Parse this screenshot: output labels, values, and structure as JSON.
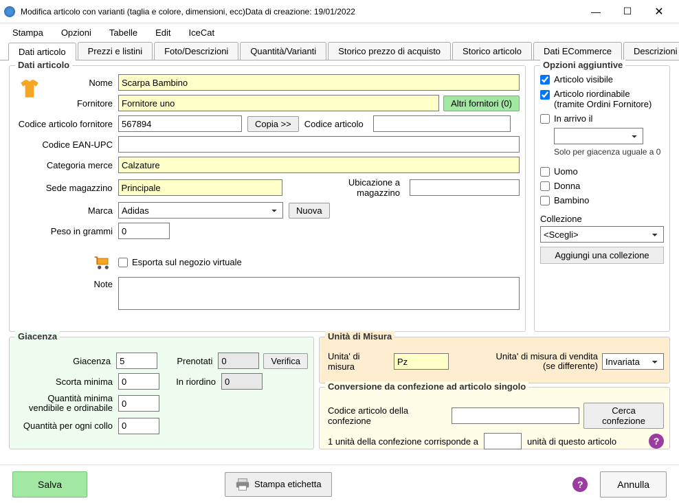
{
  "window": {
    "title": "Modifica articolo con varianti (taglia e colore, dimensioni, ecc)Data di creazione: 19/01/2022"
  },
  "menu": {
    "stampa": "Stampa",
    "opzioni": "Opzioni",
    "tabelle": "Tabelle",
    "edit": "Edit",
    "icecat": "IceCat"
  },
  "tabs": [
    "Dati articolo",
    "Prezzi e listini",
    "Foto/Descrizioni",
    "Quantità/Varianti",
    "Storico prezzo di acquisto",
    "Storico articolo",
    "Dati ECommerce",
    "Descrizioni  E..."
  ],
  "article": {
    "group_title": "Dati articolo",
    "nome_lbl": "Nome",
    "nome_val": "Scarpa Bambino",
    "fornitore_lbl": "Fornitore",
    "fornitore_val": "Fornitore uno",
    "altri_fornitori": "Altri fornitori (0)",
    "codice_fornitore_lbl": "Codice articolo fornitore",
    "codice_fornitore_val": "567894",
    "copia": "Copia >>",
    "codice_articolo_lbl": "Codice articolo",
    "codice_articolo_val": "",
    "ean_lbl": "Codice EAN-UPC",
    "ean_val": "",
    "categoria_lbl": "Categoria merce",
    "categoria_val": "Calzature",
    "sede_lbl": "Sede magazzino",
    "sede_val": "Principale",
    "ubicazione_lbl": "Ubicazione a magazzino",
    "ubicazione_val": "",
    "marca_lbl": "Marca",
    "marca_val": "Adidas",
    "nuova": "Nuova",
    "peso_lbl": "Peso in grammi",
    "peso_val": "0",
    "esporta_lbl": "Esporta sul negozio virtuale",
    "note_lbl": "Note",
    "note_val": ""
  },
  "options": {
    "group_title": "Opzioni aggiuntive",
    "visibile": "Articolo visibile",
    "riordinabile_l1": "Articolo riordinabile",
    "riordinabile_l2": "(tramite Ordini Fornitore)",
    "in_arrivo": "In arrivo il",
    "in_arrivo_val": "",
    "solo_per": "Solo per giacenza uguale a 0",
    "uomo": "Uomo",
    "donna": "Donna",
    "bambino": "Bambino",
    "collezione_lbl": "Collezione",
    "collezione_val": "<Scegli>",
    "aggiungi": "Aggiungi una collezione"
  },
  "stock": {
    "group_title": "Giacenza",
    "giacenza_lbl": "Giacenza",
    "giacenza_val": "5",
    "prenotati_lbl": "Prenotati",
    "prenotati_val": "0",
    "verifica": "Verifica",
    "scorta_lbl": "Scorta minima",
    "scorta_val": "0",
    "riordino_lbl": "In riordino",
    "riordino_val": "0",
    "qmin_lbl1": "Quantità minima",
    "qmin_lbl2": "vendibile e ordinabile",
    "qmin_val": "0",
    "collo_lbl": "Quantità per ogni collo",
    "collo_val": "0"
  },
  "uom": {
    "group_title": "Unità di Misura",
    "unita_lbl": "Unita' di misura",
    "unita_val": "Pz",
    "unita_vendita_lbl1": "Unita' di misura di vendita",
    "unita_vendita_lbl2": "(se differente)",
    "unita_vendita_val": "Invariata"
  },
  "conv": {
    "group_title": "Conversione da confezione ad articolo singolo",
    "codice_lbl": "Codice articolo della confezione",
    "codice_val": "",
    "cerca": "Cerca confezione",
    "text1": "1 unità della confezione corrisponde a",
    "text2": "unità di questo articolo",
    "val": ""
  },
  "footer": {
    "salva": "Salva",
    "etichetta": "Stampa etichetta",
    "annulla": "Annulla"
  }
}
